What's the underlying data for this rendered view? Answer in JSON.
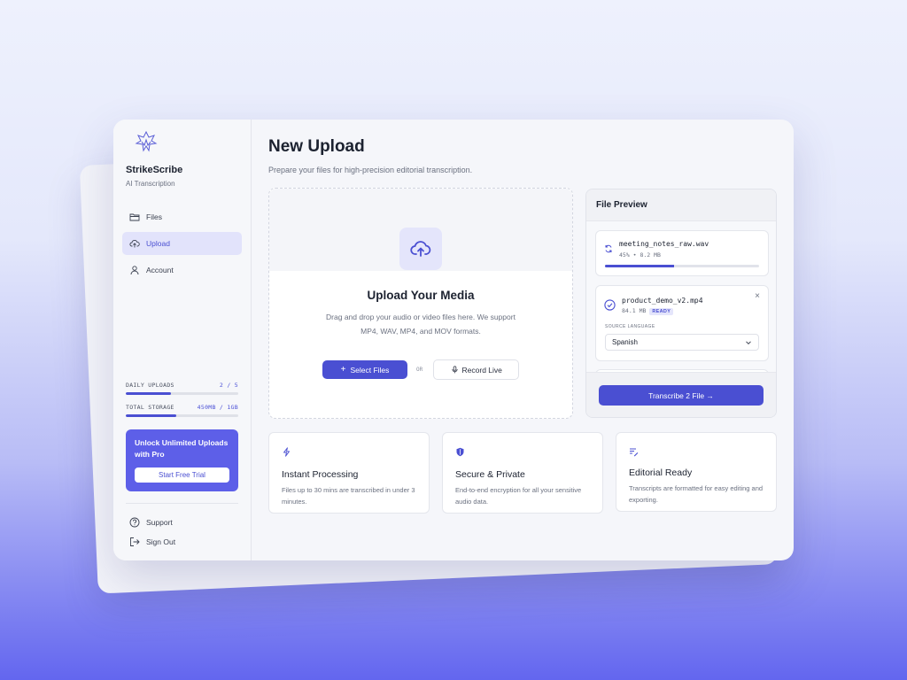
{
  "app": {
    "name": "StrikeScribe",
    "tagline": "AI Transcription"
  },
  "sidebar": {
    "nav": [
      {
        "label": "Files",
        "icon": "folder-icon",
        "active": false
      },
      {
        "label": "Upload",
        "icon": "cloud-upload-icon",
        "active": true
      },
      {
        "label": "Account",
        "icon": "user-icon",
        "active": false
      }
    ],
    "quota": {
      "daily_uploads": {
        "label": "DAILY UPLOADS",
        "value": "2 / 5",
        "fraction": 0.4
      },
      "total_storage": {
        "label": "TOTAL STORAGE",
        "value": "450MB / 1GB",
        "fraction": 0.45
      }
    },
    "promo": {
      "title": "Unlock Unlimited Uploads with Pro",
      "button": "Start Free Trial"
    },
    "bottom": [
      {
        "label": "Support",
        "icon": "help-icon"
      },
      {
        "label": "Sign Out",
        "icon": "sign-out-icon"
      }
    ]
  },
  "main": {
    "title": "New Upload",
    "subtitle": "Prepare your files for high-precision editorial transcription.",
    "dropzone": {
      "title": "Upload Your Media",
      "description": "Drag and drop your audio or video files here. We support MP4, WAV, MP4, and MOV formats.",
      "select_button": "Select Files",
      "or_label": "OR",
      "record_button": "Record Live"
    },
    "preview": {
      "title": "File Preview",
      "files": [
        {
          "name": "meeting_notes_raw.wav",
          "meta": "45% • 8.2 MB",
          "progress": 0.45,
          "status": "uploading"
        },
        {
          "name": "product_demo_v2.mp4",
          "meta": "84.1 MB",
          "badge": "READY",
          "status": "ready",
          "source_language_label": "SOURCE LANGUAGE",
          "source_language": "Spanish"
        }
      ],
      "transcribe_button": "Transcribe 2 File →"
    },
    "features": [
      {
        "title": "Instant Processing",
        "description": "Files up to 30 mins are transcribed in under 3 minutes.",
        "icon": "lightning-icon"
      },
      {
        "title": "Secure & Private",
        "description": "End-to-end encryption for all your sensitive audio data.",
        "icon": "shield-icon"
      },
      {
        "title": "Editorial Ready",
        "description": "Transcripts are formatted for easy editing and exporting.",
        "icon": "edit-lines-icon"
      }
    ]
  },
  "colors": {
    "accent": "#4a4fd2",
    "promo": "#5d5fe8",
    "active_nav_bg": "#e2e3fb"
  }
}
